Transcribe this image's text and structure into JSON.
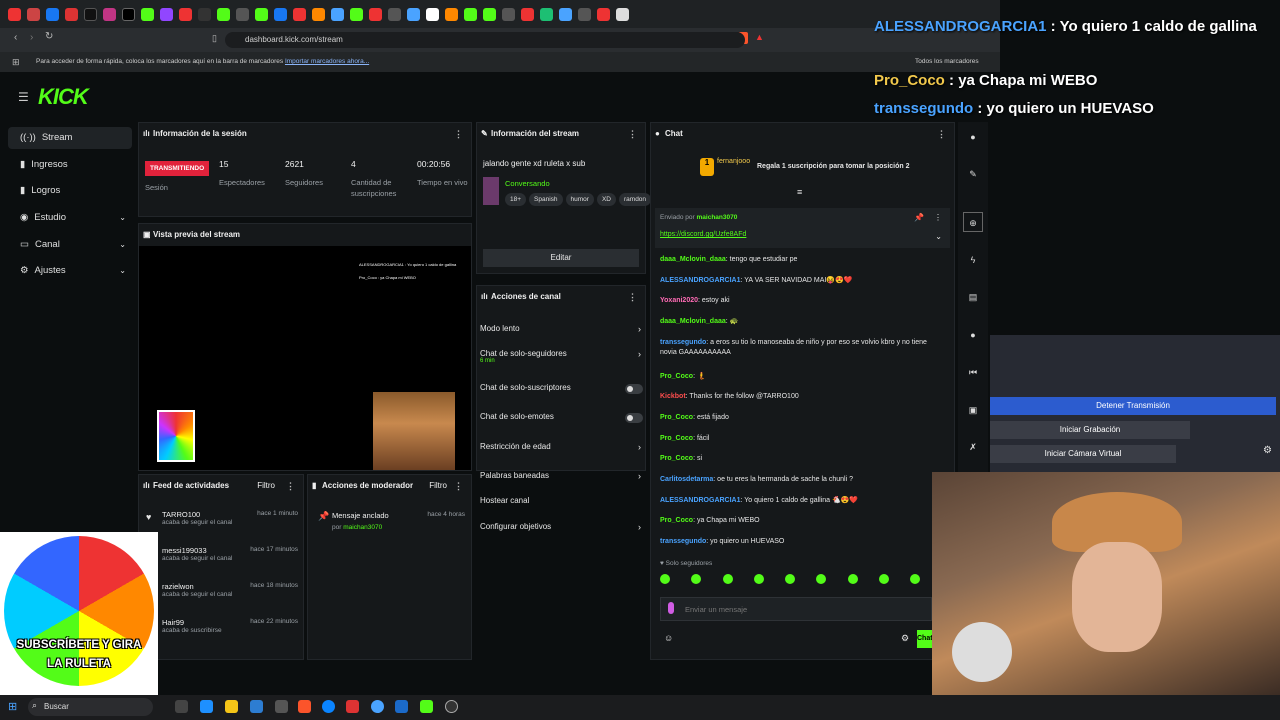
{
  "browser": {
    "url": "dashboard.kick.com/stream",
    "bookmarks_hint": "Para acceder de forma rápida, coloca los marcadores aquí en la barra de marcadores",
    "bookmarks_link": "Importar marcadores ahora...",
    "all_bookmarks": "Todos los marcadores"
  },
  "brand": {
    "logo": "KICK",
    "accent": "#53fc18"
  },
  "sidebar": {
    "items": [
      {
        "label": "Stream",
        "icon": "stream-icon"
      },
      {
        "label": "Ingresos",
        "icon": "income-icon"
      },
      {
        "label": "Logros",
        "icon": "achievements-icon"
      },
      {
        "label": "Estudio",
        "icon": "studio-icon",
        "chevron": "⌄"
      },
      {
        "label": "Canal",
        "icon": "channel-icon",
        "chevron": "⌄"
      },
      {
        "label": "Ajustes",
        "icon": "settings-icon",
        "chevron": "⌄"
      }
    ]
  },
  "session": {
    "title": "Información de la sesión",
    "live_badge": "TRANSMITIENDO",
    "live_label": "Sesión",
    "stats": [
      {
        "value": "15",
        "label": "Espectadores"
      },
      {
        "value": "2621",
        "label": "Seguidores"
      },
      {
        "value": "4",
        "label": "Cantidad de suscripciones"
      },
      {
        "value": "00:20:56",
        "label": "Tiempo en vivo"
      }
    ]
  },
  "stream_info": {
    "title": "Información del stream",
    "stream_title": "jalando gente xd ruleta x sub",
    "category": "Conversando",
    "tags": [
      "18+",
      "Spanish",
      "humor",
      "XD",
      "ramdon"
    ],
    "edit_label": "Editar"
  },
  "preview": {
    "title": "Vista previa del stream",
    "mini_line1": "ALESSANDROGARCIA1 : Yo quiero 1 caldo de gallina",
    "mini_line2": "Pro_Coco : ya Chapa mi WEBO"
  },
  "channel_actions": {
    "title": "Acciones de canal",
    "items": [
      {
        "label": "Modo lento",
        "control": "arrow"
      },
      {
        "label": "Chat de solo-seguidores",
        "sub": "6 min",
        "control": "arrow"
      },
      {
        "label": "Chat de solo-suscriptores",
        "control": "toggle"
      },
      {
        "label": "Chat de solo-emotes",
        "control": "toggle"
      },
      {
        "label": "Restricción de edad",
        "control": "arrow"
      },
      {
        "label": "Palabras baneadas",
        "control": "arrow"
      },
      {
        "label": "Hostear canal",
        "control": "none"
      },
      {
        "label": "Configurar objetivos",
        "control": "arrow"
      }
    ]
  },
  "activity": {
    "title": "Feed de actividades",
    "filter": "Filtro",
    "items": [
      {
        "name": "TARRO100",
        "action": "acaba de seguir el canal",
        "time": "hace 1 minuto"
      },
      {
        "name": "messi199033",
        "action": "acaba de seguir el canal",
        "time": "hace 17 minutos"
      },
      {
        "name": "razielwon",
        "action": "acaba de seguir el canal",
        "time": "hace 18 minutos"
      },
      {
        "name": "Hair99",
        "action": "acaba de suscribirse",
        "time": "hace 22 minutos"
      }
    ]
  },
  "moderator": {
    "title": "Acciones de moderador",
    "filter": "Filtro",
    "item_title": "Mensaje anclado",
    "item_by": "por",
    "item_user": "maichan3070",
    "item_time": "hace 4 horas"
  },
  "chat": {
    "title": "Chat",
    "gift_user": "fernanjooo",
    "gift_count": "1",
    "gift_text": "Regala 1 suscripción para tomar la posición 2",
    "pinned_by_label": "Enviado por",
    "pinned_user": "maichan3070",
    "pinned_link": "https://discord.gg/Uzfe8AFd",
    "messages": [
      {
        "user": "daaa_Mclovin_daaa",
        "color": "u-green",
        "text": ": tengo que estudiar pe"
      },
      {
        "user": "ALESSANDROGARCIA1",
        "color": "u-blue",
        "text": ": YA VA SER NAVIDAD MAI😝😍❤️"
      },
      {
        "user": "Yoxani2020",
        "color": "u-pink",
        "text": ": estoy aki"
      },
      {
        "user": "daaa_Mclovin_daaa",
        "color": "u-green",
        "text": ": 🐢"
      },
      {
        "user": "transsegundo",
        "color": "u-blue",
        "text": ": a eros su tio lo manoseaba de niño y por eso se volvio kbro y no tiene novia GAAAAAAAAAA"
      },
      {
        "user": "Pro_Coco",
        "color": "u-green",
        "text": ": 🧜"
      },
      {
        "user": "Kickbot",
        "color": "u-red",
        "text": ": Thanks for the follow @TARRO100"
      },
      {
        "user": "Pro_Coco",
        "color": "u-green",
        "text": ": está fijado"
      },
      {
        "user": "Pro_Coco",
        "color": "u-green",
        "text": ": fácil"
      },
      {
        "user": "Pro_Coco",
        "color": "u-green",
        "text": ": si"
      },
      {
        "user": "Carlitosdetarma",
        "color": "u-blue",
        "text": ": oe tu eres la hermanda de sache la chunli ?"
      },
      {
        "user": "ALESSANDROGARCIA1",
        "color": "u-blue",
        "text": ": Yo quiero 1 caldo de gallina 🐔😍❤️"
      },
      {
        "user": "Pro_Coco",
        "color": "u-green",
        "text": ": ya Chapa mi WEBO"
      },
      {
        "user": "transsegundo",
        "color": "u-blue",
        "text": ": yo quiero un HUEVASO"
      }
    ],
    "followers_only": "Solo seguidores",
    "input_placeholder": "Enviar un mensaje",
    "send_label": "Chat"
  },
  "overlay": {
    "lines": [
      {
        "user": "ALESSANDROGARCIA1",
        "text": " : Yo quiero 1 caldo de gallina",
        "color": "#4aa3ff"
      },
      {
        "user": "Pro_Coco",
        "text": " : ya Chapa mi WEBO",
        "color": "#f2c94c"
      },
      {
        "user": "transsegundo",
        "text": " : yo quiero un HUEVASO",
        "color": "#4aa3ff"
      }
    ],
    "wheel_text": "SUBSCRÍBETE Y GIRA LA RULETA"
  },
  "obs": {
    "stop_stream": "Detener Transmisión",
    "start_recording": "Iniciar Grabación",
    "start_vcam": "Iniciar Cámara Virtual"
  },
  "taskbar": {
    "search": "Buscar"
  }
}
